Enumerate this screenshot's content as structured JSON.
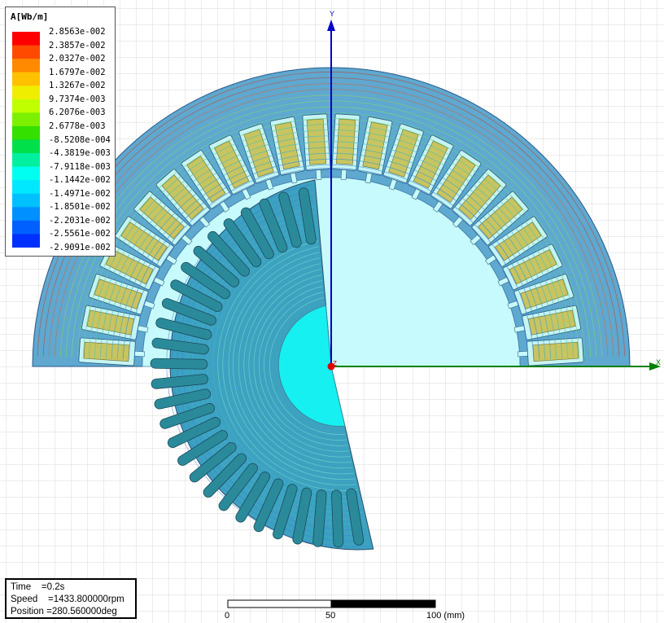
{
  "legend": {
    "title": "A[Wb/m]",
    "values": [
      "2.8563e-002",
      "2.3857e-002",
      "2.0327e-002",
      "1.6797e-002",
      "1.3267e-002",
      "9.7374e-003",
      "6.2076e-003",
      "2.6778e-003",
      "-8.5208e-004",
      "-4.3819e-003",
      "-7.9118e-003",
      "-1.1442e-002",
      "-1.4971e-002",
      "-1.8501e-002",
      "-2.2031e-002",
      "-2.5561e-002",
      "-2.9091e-002"
    ],
    "colors": [
      "#ff0000",
      "#ff4a00",
      "#ff8a00",
      "#ffc000",
      "#f0ee00",
      "#c0ff00",
      "#7cf000",
      "#33e000",
      "#00e04a",
      "#00f0a0",
      "#00fff0",
      "#00e8ff",
      "#00c0ff",
      "#0090ff",
      "#0060ff",
      "#0030ff",
      "#0000ff"
    ]
  },
  "axes": {
    "x_label": "X",
    "y_label": "Y",
    "z_label": "Z"
  },
  "info": {
    "time": "Time    =0.2s",
    "speed": "Speed    =1433.800000rpm",
    "position": "Position =280.560000deg"
  },
  "scale": {
    "labels": [
      "0",
      "50",
      "100 (mm)"
    ]
  },
  "model": {
    "stator_slots": 24,
    "rotor_bars": 28,
    "stator_color": "#5fa8d0",
    "coil_color": "#c8c460",
    "rotor_color": "#3ca2c0",
    "shaft_color": "#16f0f0",
    "air_color": "#c6fafc"
  }
}
